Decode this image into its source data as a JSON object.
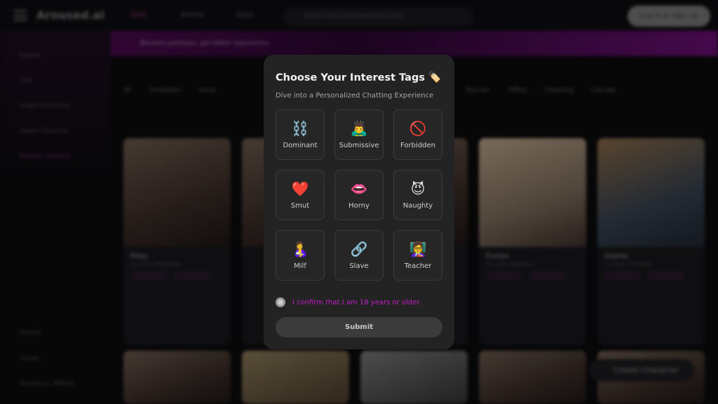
{
  "header": {
    "logo": "Aroused.ai",
    "nav": [
      "Girls",
      "Anime",
      "Guys"
    ],
    "search_placeholder": "Search for your passionate kink",
    "login": "Log in or sign up"
  },
  "sidebar": {
    "items": [
      "Explore",
      "Chat",
      "Image Generation",
      "Create Character",
      "Premium Features"
    ],
    "bottom": [
      "Discord",
      "Socials",
      "Become an Affiliate"
    ]
  },
  "banner": "Become premium, get better experience",
  "filters": [
    "All",
    "Forbidden",
    "Smut",
    "Teacher",
    "Office",
    "Cheating",
    "Life-like"
  ],
  "cards": [
    {
      "name": "Riley",
      "sub": "21 years, Roommate"
    },
    {
      "name": "",
      "sub": ""
    },
    {
      "name": "",
      "sub": ""
    },
    {
      "name": "Evelyn",
      "sub": "22 years, Stepmom"
    },
    {
      "name": "Sophie",
      "sub": "23 years, Coworker"
    }
  ],
  "create_character": "Create Character",
  "modal": {
    "title": "Choose Your Interest Tags 🏷️",
    "subtitle": "Dive into a Personalized Chatting Experience",
    "tags": [
      {
        "icon": "⛓️",
        "label": "Dominant"
      },
      {
        "icon": "🙇‍♂️",
        "label": "Submissive"
      },
      {
        "icon": "🚫",
        "label": "Forbidden"
      },
      {
        "icon": "❤️",
        "label": "Smut"
      },
      {
        "icon": "👄",
        "label": "Horny"
      },
      {
        "icon": "😈",
        "label": "Naughty"
      },
      {
        "icon": "🤱",
        "label": "Milf"
      },
      {
        "icon": "🔗",
        "label": "Slave"
      },
      {
        "icon": "👩‍🏫",
        "label": "Teacher"
      }
    ],
    "confirm": "I confirm that I am 18 years or older.",
    "confirm_checked": false,
    "submit": "Submit",
    "accent": "#c21ec4"
  }
}
